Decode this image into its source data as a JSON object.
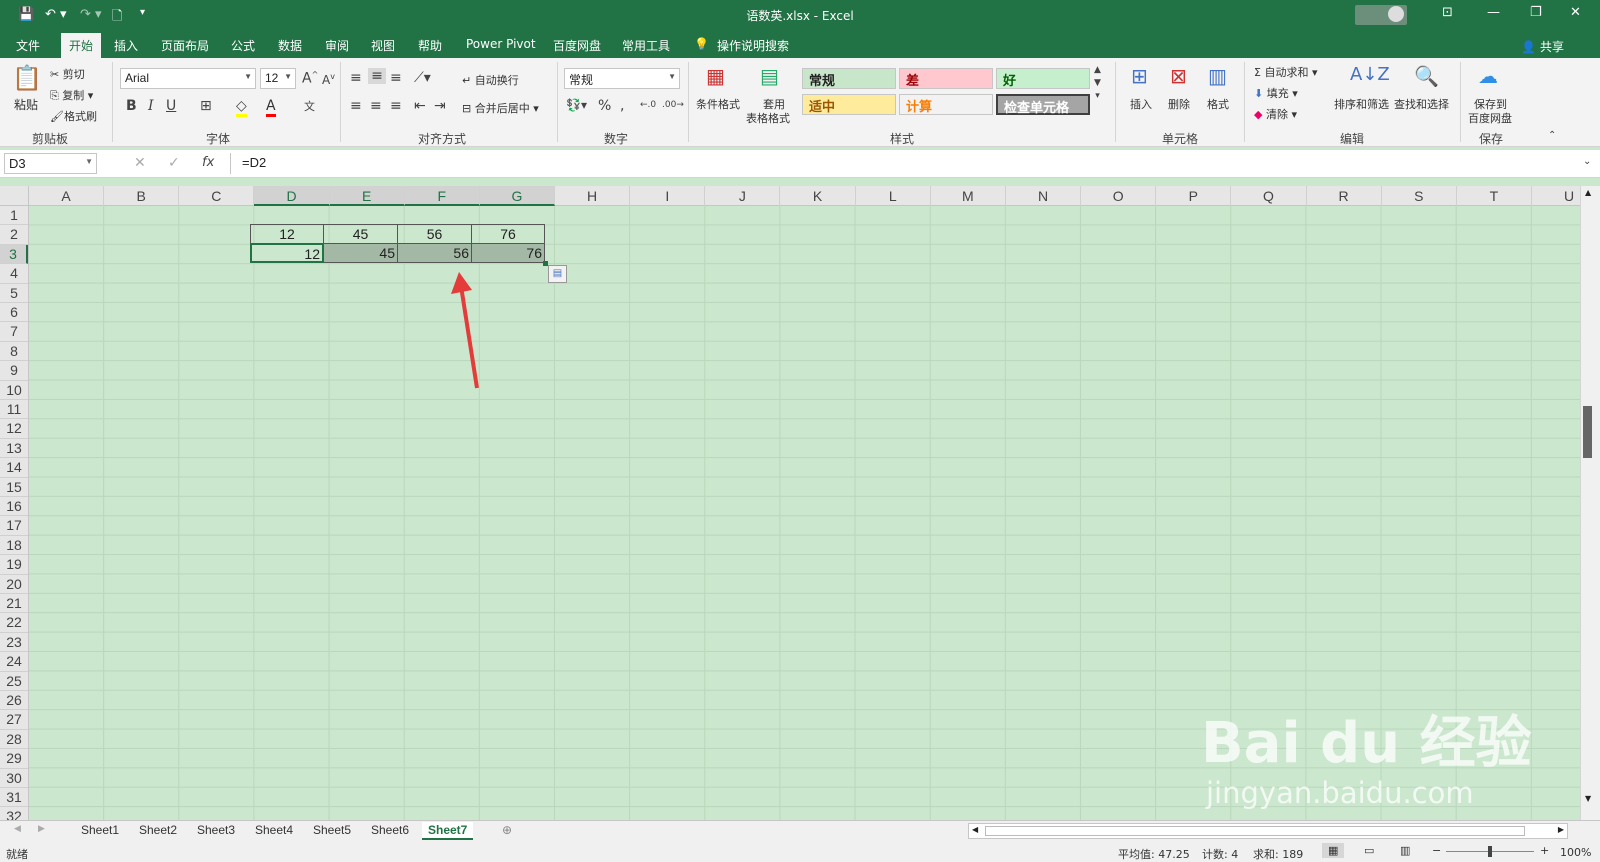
{
  "title_bar": {
    "title": "语数英.xlsx - Excel"
  },
  "tabs": [
    "文件",
    "开始",
    "插入",
    "页面布局",
    "公式",
    "数据",
    "审阅",
    "视图",
    "帮助",
    "Power Pivot",
    "百度网盘",
    "常用工具"
  ],
  "tell_me": "操作说明搜索",
  "share": "共享",
  "clipboard": {
    "paste": "粘贴",
    "cut": "剪切",
    "copy": "复制",
    "format_painter": "格式刷",
    "label": "剪贴板"
  },
  "font": {
    "name": "Arial",
    "size": "12",
    "label": "字体"
  },
  "alignment": {
    "wrap": "自动换行",
    "merge": "合并后居中",
    "label": "对齐方式"
  },
  "number": {
    "format": "常规",
    "label": "数字"
  },
  "styles": {
    "conditional": "条件格式",
    "table_format_1": "套用",
    "table_format_2": "表格格式",
    "normal": "常规",
    "bad": "差",
    "good": "好",
    "neutral": "适中",
    "calc": "计算",
    "check": "检查单元格",
    "label": "样式"
  },
  "cells": {
    "insert": "插入",
    "delete": "删除",
    "format": "格式",
    "label": "单元格"
  },
  "editing": {
    "autosum": "自动求和",
    "fill": "填充",
    "clear": "清除",
    "sort": "排序和筛选",
    "find": "查找和选择",
    "label": "编辑"
  },
  "save": {
    "line1": "保存到",
    "line2": "百度网盘",
    "label": "保存"
  },
  "formula_bar": {
    "name_box": "D3",
    "formula": "=D2",
    "fx": "fx"
  },
  "columns": [
    "A",
    "B",
    "C",
    "D",
    "E",
    "F",
    "G",
    "H",
    "I",
    "J",
    "K",
    "L",
    "M",
    "N",
    "O",
    "P",
    "Q",
    "R",
    "S",
    "T",
    "U"
  ],
  "rows": [
    "1",
    "2",
    "3",
    "4",
    "5",
    "6",
    "7",
    "8",
    "9",
    "10",
    "11",
    "12",
    "13",
    "14",
    "15",
    "16",
    "17",
    "18",
    "19",
    "20",
    "21",
    "22",
    "23",
    "24",
    "25",
    "26",
    "27",
    "28",
    "29",
    "30",
    "31",
    "32"
  ],
  "row2": [
    "12",
    "45",
    "56",
    "76"
  ],
  "row3": [
    "12",
    "45",
    "56",
    "76"
  ],
  "sheets": [
    "Sheet1",
    "Sheet2",
    "Sheet3",
    "Sheet4",
    "Sheet5",
    "Sheet6",
    "Sheet7"
  ],
  "status": {
    "ready": "就绪",
    "average": "平均值: 47.25",
    "count": "计数: 4",
    "sum": "求和: 189",
    "zoom": "100%"
  },
  "watermark": {
    "line1": "Bai du 经验",
    "line2": "jingyan.baidu.com"
  }
}
